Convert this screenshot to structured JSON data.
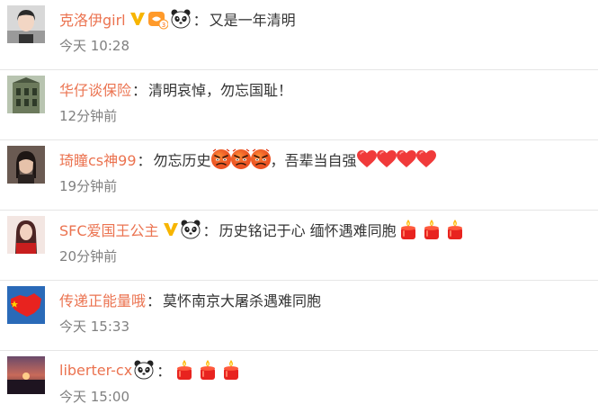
{
  "comments": [
    {
      "username": "克洛伊girl",
      "badges": [
        "verified-v-icon",
        "fan-badge-icon",
        "panda-icon"
      ],
      "content": "又是一年清明",
      "time": "今天 10:28"
    },
    {
      "username": "华仔谈保险",
      "badges": [],
      "content": "清明哀悼，勿忘国耻！",
      "time": "12分钟前"
    },
    {
      "username": "琦瞳cs神99",
      "badges": [],
      "content_parts": [
        "勿忘历史",
        "，吾辈当自强"
      ],
      "emojis_mid": [
        "angry-face-icon",
        "angry-face-icon",
        "angry-face-icon"
      ],
      "emojis_end": [
        "heart-icon",
        "heart-icon",
        "heart-icon",
        "heart-icon"
      ],
      "time": "19分钟前"
    },
    {
      "username": "SFC爱国王公主",
      "badges": [
        "verified-v-icon",
        "panda-icon"
      ],
      "content": "历史铭记于心 缅怀遇难同胞",
      "emojis_end": [
        "candle-icon",
        "candle-icon",
        "candle-icon"
      ],
      "time": "20分钟前"
    },
    {
      "username": "传递正能量哦",
      "badges": [],
      "content": "莫怀南京大屠杀遇难同胞",
      "time": "今天 15:33"
    },
    {
      "username": "liberter-cx",
      "badges": [
        "panda-icon"
      ],
      "content": "",
      "emojis_end": [
        "candle-icon",
        "candle-icon",
        "candle-icon"
      ],
      "time": "今天 15:00"
    }
  ],
  "colon": "：",
  "colors": {
    "username": "#eb7350",
    "text": "#333333",
    "time": "#808080",
    "divider": "#e6e6e6",
    "verified": "#f7b500"
  }
}
